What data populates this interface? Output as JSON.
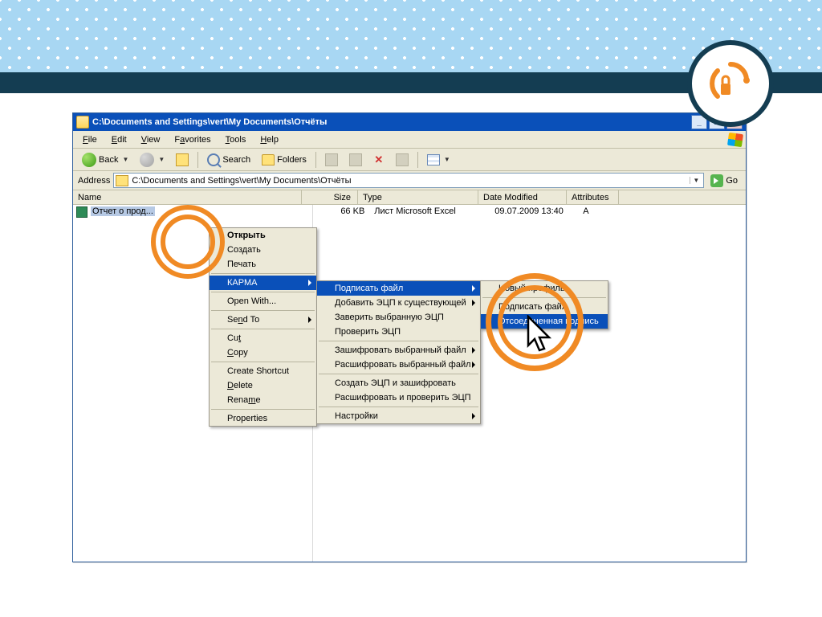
{
  "titlebar": {
    "title": "C:\\Documents and Settings\\vert\\My Documents\\Отчёты"
  },
  "menubar": {
    "file": "File",
    "edit": "Edit",
    "view": "View",
    "favorites": "Favorites",
    "tools": "Tools",
    "help": "Help"
  },
  "toolbar": {
    "back": "Back",
    "search": "Search",
    "folders": "Folders"
  },
  "addressbar": {
    "label": "Address",
    "path": "C:\\Documents and Settings\\vert\\My Documents\\Отчёты",
    "go": "Go"
  },
  "columns": {
    "name": "Name",
    "size": "Size",
    "type": "Type",
    "date": "Date Modified",
    "attr": "Attributes"
  },
  "file": {
    "name": "Отчет о прод...",
    "size": "66 KB",
    "type": "Лист Microsoft Excel",
    "date": "09.07.2009 13:40",
    "attr": "A"
  },
  "ctx1": {
    "open": "Открыть",
    "create": "Создать",
    "print": "Печать",
    "karma": "КАРМА",
    "openwith": "Open With...",
    "sendto": "Send To",
    "cut": "Cut",
    "copy": "Copy",
    "shortcut": "Create Shortcut",
    "delete": "Delete",
    "rename": "Rename",
    "props": "Properties"
  },
  "ctx2": {
    "sign": "Подписать файл",
    "addsig": "Добавить ЭЦП к существующей",
    "certify": "Заверить выбранную ЭЦП",
    "verify": "Проверить ЭЦП",
    "encrypt": "Зашифровать выбранный файл",
    "decrypt": "Расшифровать выбранный файл",
    "signenc": "Создать ЭЦП и зашифровать",
    "decver": "Расшифровать и проверить ЭЦП",
    "settings": "Настройки"
  },
  "ctx3": {
    "i1": "Новый профиль",
    "i2": "Подписать файл",
    "i3": "Отсоединенная подпись"
  }
}
